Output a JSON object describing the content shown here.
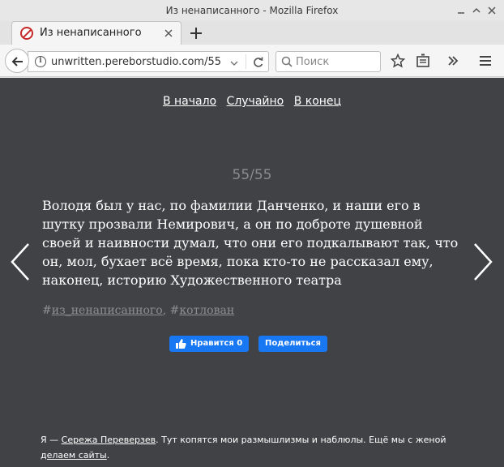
{
  "window": {
    "title": "Из ненаписанного - Mozilla Firefox",
    "tab_label": "Из ненаписанного"
  },
  "navbar": {
    "url": "unwritten.pereborstudio.com/55",
    "search_placeholder": "Поиск"
  },
  "page": {
    "nav": {
      "home": "В начало",
      "random": "Случайно",
      "end": "В конец"
    },
    "counter": "55/55",
    "quote": "Володя был у нас, по фамилии Данченко, и наши его в шутку прозвали Немирович, а он по доброте душевной своей и наивности думал, что они его подкалывают так, что он, мол, бухает всё время, пока кто-то не рассказал ему, наконец, историю Художественного театра",
    "tags": {
      "hash1": "#",
      "tag1": "из_ненаписанного",
      "sep": ", #",
      "tag2": "котлован"
    },
    "like_label": "Нравится 0",
    "share_label": "Поделиться",
    "footer": {
      "prefix": "Я — ",
      "author": "Сережа Переверзев",
      "middle": ". Тут копятся мои размышлизмы и наблюлы. Ещё мы с женой ",
      "link": "делаем сайты",
      "suffix": "."
    }
  },
  "icons": [
    "close-icon",
    "new-tab-icon",
    "back-icon",
    "info-icon",
    "reload-icon",
    "search-icon",
    "bookmark-star-icon",
    "reading-list-icon",
    "overflow-icon",
    "menu-icon",
    "prev-arrow-icon",
    "next-arrow-icon",
    "thumbs-up-icon"
  ]
}
